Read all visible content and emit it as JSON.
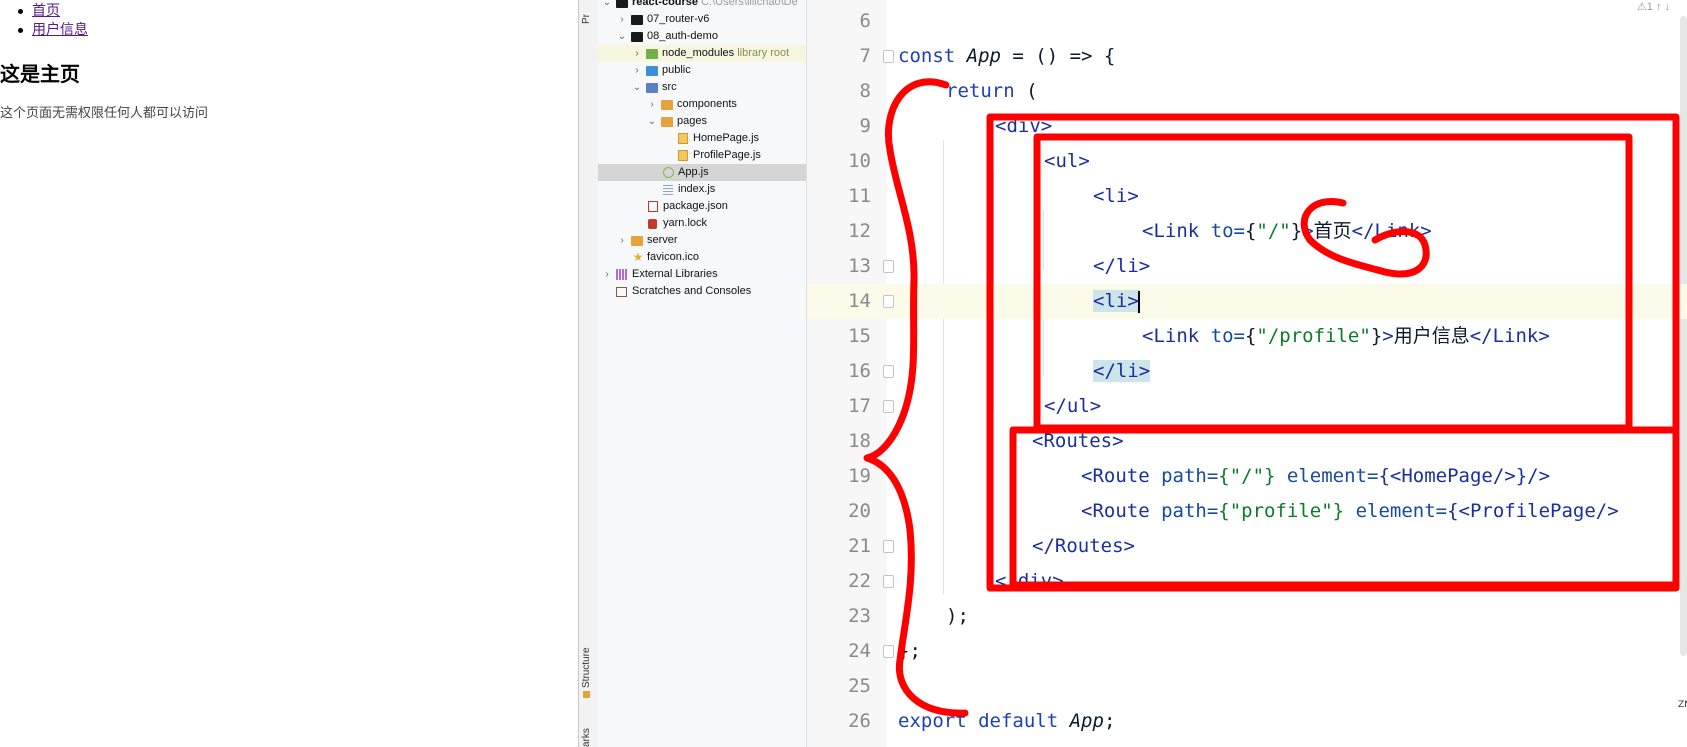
{
  "browser": {
    "nav_links": [
      "首页",
      "用户信息"
    ],
    "heading": "这是主页",
    "description": "这个页面无需权限任何人都可以访问"
  },
  "tool_strip": {
    "top_tab": "Pr",
    "structure_tab": "Structure",
    "bookmarks_tab": "arks"
  },
  "project_tree": {
    "rows": [
      {
        "label": "react-course",
        "hint": "C:\\Users\\lilichao\\De",
        "arrow": "⌄",
        "icon": "folder-black"
      },
      {
        "label": "07_router-v6",
        "arrow": "›",
        "icon": "folder-black"
      },
      {
        "label": "08_auth-demo",
        "arrow": "⌄",
        "icon": "folder-black"
      },
      {
        "label": "node_modules",
        "hint": "library root",
        "arrow": "›",
        "icon": "folder-green"
      },
      {
        "label": "public",
        "arrow": "›",
        "icon": "folder-blue"
      },
      {
        "label": "src",
        "arrow": "⌄",
        "icon": "folder-src"
      },
      {
        "label": "components",
        "arrow": "›",
        "icon": "folder-orange"
      },
      {
        "label": "pages",
        "arrow": "⌄",
        "icon": "folder-orange"
      },
      {
        "label": "HomePage.js",
        "icon": "file-js"
      },
      {
        "label": "ProfilePage.js",
        "icon": "file-js"
      },
      {
        "label": "App.js",
        "icon": "file-react"
      },
      {
        "label": "index.js",
        "icon": "file-idx"
      },
      {
        "label": "package.json",
        "icon": "file-pkg"
      },
      {
        "label": "yarn.lock",
        "icon": "file-lock"
      },
      {
        "label": "server",
        "arrow": "›",
        "icon": "folder-orange"
      },
      {
        "label": "favicon.ico",
        "icon": "file-star"
      },
      {
        "label": "External Libraries",
        "arrow": "›",
        "icon": "libs"
      },
      {
        "label": "Scratches and Consoles",
        "icon": "scratch"
      }
    ]
  },
  "editor": {
    "top_info": "⚠1 ↑ ↓",
    "edge_tab": "ZN",
    "line_numbers": [
      "6",
      "7",
      "8",
      "9",
      "10",
      "11",
      "12",
      "13",
      "14",
      "15",
      "16",
      "17",
      "18",
      "19",
      "20",
      "21",
      "22",
      "23",
      "24",
      "25",
      "26"
    ],
    "code": {
      "l7_kw": "const",
      "l7_name": "App",
      "l7_rest": " = () => {",
      "l8_kw": "return",
      "l8_rest": " (",
      "l9": "<div>",
      "l10": "<ul>",
      "l11": "<li>",
      "l12_open": "<Link",
      "l12_attr": " to=",
      "l12_lb": "{",
      "l12_str": "\"/\"",
      "l12_rb": "}",
      "l12_gt": ">",
      "l12_text": "首页",
      "l12_close": "</Link>",
      "l13": "</li>",
      "l14": "<li>",
      "l15_open": "<Link",
      "l15_attr": " to=",
      "l15_lb": "{",
      "l15_str": "\"/profile\"",
      "l15_rb": "}",
      "l15_gt": ">",
      "l15_text": "用户信息",
      "l15_close": "</Link>",
      "l16": "</li>",
      "l17": "</ul>",
      "l18": "<Routes>",
      "l19_open": "<Route",
      "l19_attr1": " path=",
      "l19_str": "{\"/\"}",
      "l19_attr2": " element=",
      "l19_val": "{<HomePage/>}",
      "l19_close": "/>",
      "l20_open": "<Route",
      "l20_attr1": " path=",
      "l20_str": "{\"profile\"}",
      "l20_attr2": " element=",
      "l20_val": "{<ProfilePage/>",
      "l21": "</Routes>",
      "l22": "</div>",
      "l23": ");",
      "l24": "};",
      "l26_kw": "export default",
      "l26_name": "App",
      "l26_semi": ";"
    }
  },
  "annotation_colors": {
    "marker": "#ff0000"
  }
}
